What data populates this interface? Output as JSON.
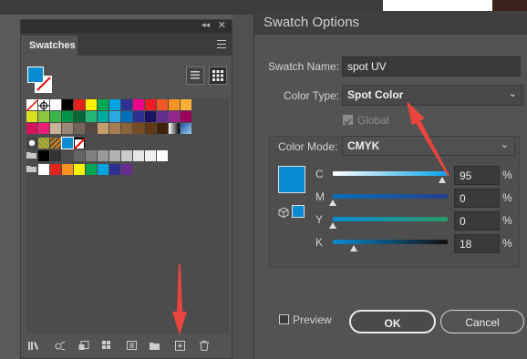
{
  "swatches_panel": {
    "tab_label": "Swatches",
    "collapse_glyph": "◂◂",
    "close_glyph": "✕",
    "fill_color": "#0a8bd2",
    "grid_rows": [
      [
        "none",
        "register",
        "#ffffff",
        "#000000",
        "#e2231a",
        "#fff200",
        "#00a651",
        "#00a3e0",
        "#2e3192",
        "#ec008c",
        "#ed1c24",
        "#f15a24",
        "#f7931e",
        "#fbb03b"
      ],
      [
        "#d9e021",
        "#8cc63f",
        "#39b54a",
        "#009245",
        "#006837",
        "#22b573",
        "#00a99d",
        "#29abe2",
        "#0071bc",
        "#2e3192",
        "#1b1464",
        "#662d91",
        "#93278f",
        "#9e005d"
      ],
      [
        "#d4145a",
        "#ed1e79",
        "#c7b299",
        "#998675",
        "#736357",
        "#534741",
        "#c69c6d",
        "#a67c52",
        "#8c6239",
        "#754c24",
        "#603813",
        "#42210b",
        "gradient-bw",
        "gradient-blue"
      ],
      [
        "pattern-a",
        "pattern-b",
        "pattern-c",
        "#0a8bd2",
        "red-slash"
      ],
      [
        "folder",
        "#000000",
        "#333333",
        "#4d4d4d",
        "#666666",
        "#808080",
        "#999999",
        "#b3b3b3",
        "#cccccc",
        "#e6e6e6",
        "#f2f2f2",
        "#ffffff"
      ],
      [
        "folder",
        "#ffffff",
        "#e2231a",
        "#f7931e",
        "#fff200",
        "#00a651",
        "#00a3e0",
        "#2e3192",
        "#662d91"
      ]
    ],
    "bottom_icons": [
      "library-icon",
      "show-kinds-icon",
      "swatch-options-icon",
      "color-group-icon",
      "new-color-group-icon",
      "folder-icon",
      "new-swatch-icon",
      "delete-icon"
    ]
  },
  "dialog": {
    "title": "Swatch Options",
    "swatch_name_label": "Swatch Name:",
    "swatch_name_value": "spot UV",
    "color_type_label": "Color Type:",
    "color_type_value": "Spot Color",
    "global_label": "Global",
    "color_mode_label": "Color Mode:",
    "color_mode_value": "CMYK",
    "preview_color": "#0a8bd2",
    "channels": [
      {
        "label": "C",
        "value": "95",
        "unit": "%",
        "level": 0.95
      },
      {
        "label": "M",
        "value": "0",
        "unit": "%",
        "level": 0
      },
      {
        "label": "Y",
        "value": "0",
        "unit": "%",
        "level": 0
      },
      {
        "label": "K",
        "value": "18",
        "unit": "%",
        "level": 0.18
      }
    ],
    "preview_label": "Preview",
    "ok_label": "OK",
    "cancel_label": "Cancel"
  },
  "annotation_color": "#e8463c"
}
